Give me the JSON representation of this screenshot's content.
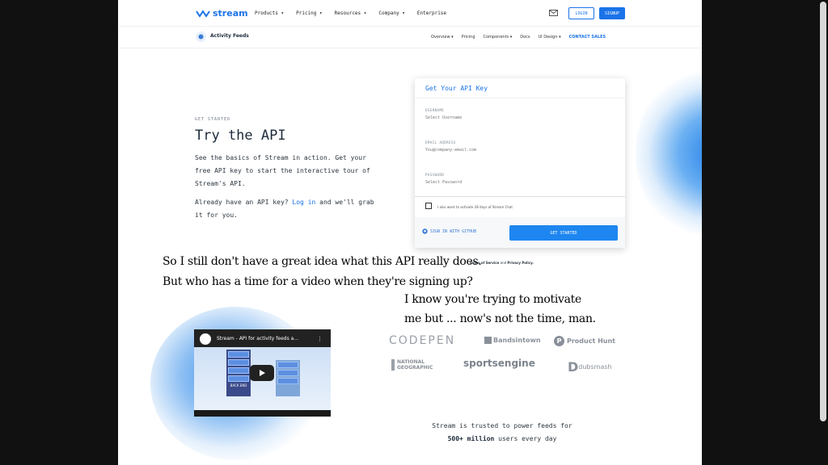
{
  "nav": {
    "logo_text": "stream",
    "items": [
      "Products ▾",
      "Pricing ▾",
      "Resources ▾",
      "Company ▾",
      "Enterprise"
    ],
    "login": "LOGIN",
    "signup": "SIGNUP"
  },
  "subnav": {
    "title": "Activity Feeds",
    "items": [
      "Overview ▾",
      "Pricing",
      "Components ▾",
      "Docs",
      "UI Design ▾"
    ],
    "cta": "CONTACT SALES"
  },
  "hero": {
    "eyebrow": "GET STARTED",
    "title": "Try the API",
    "description": "See the basics of Stream in action. Get your free API key to start the interactive tour of Stream's API.",
    "already_prefix": "Already have an API key? ",
    "login_link": "Log in",
    "already_suffix": " and we'll grab it for you."
  },
  "form": {
    "title": "Get Your API Key",
    "username_label": "USERNAME",
    "username_placeholder": "Select Username",
    "email_label": "EMAIL ADDRESS",
    "email_placeholder": "You@company-email.com",
    "password_label": "PASSWORD",
    "password_placeholder": "Select Password",
    "checkbox_label": "I also want to activate 28 days of Stream Chat",
    "github_label": "SIGN IN WITH GITHUB",
    "submit_label": "GET STARTED",
    "terms_bold1": "Terms of Service",
    "terms_and": " and ",
    "terms_bold2": "Privacy Policy."
  },
  "annotations": {
    "line1": "So I still don't have a great idea what this API really does.",
    "line2": "But who has a time for a video when they're signing up?",
    "line3": "I know you're trying to motivate",
    "line4": "me but ... now's not the time, man."
  },
  "video": {
    "title": "Stream - API for activity feeds a...",
    "server_label": "BACK END"
  },
  "logos": {
    "codepen": "CODEPEN",
    "bandsintown": "Bandsintown",
    "producthunt": "Product Hunt",
    "natgeo_line1": "NATIONAL",
    "natgeo_line2": "GEOGRAPHIC",
    "sportsengine": "sportsengine",
    "dubsmash": "dubsmash"
  },
  "trusted": {
    "line1": "Stream is trusted to power feeds for",
    "bold": "500+ million",
    "line2_suffix": " users every day"
  },
  "colors": {
    "accent": "#1a73e8",
    "button": "#1e86f0"
  }
}
